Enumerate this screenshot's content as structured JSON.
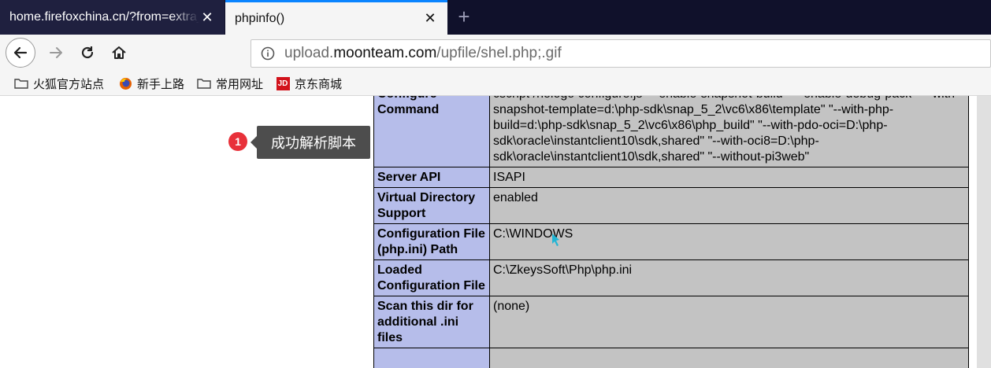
{
  "tabs": [
    {
      "title": "home.firefoxchina.cn/?from=extra_start",
      "active": false
    },
    {
      "title": "phpinfo()",
      "active": true
    }
  ],
  "nav": {
    "url_prefix": "upload.",
    "url_domain": "moonteam.com",
    "url_path": "/upfile/shel.php;.gif"
  },
  "bookmarks": [
    {
      "label": "火狐官方站点",
      "icon": "folder-icon"
    },
    {
      "label": "新手上路",
      "icon": "firefox-icon"
    },
    {
      "label": "常用网址",
      "icon": "folder-icon"
    },
    {
      "label": "京东商城",
      "icon": "jd-icon",
      "icon_text": "JD"
    }
  ],
  "tooltip": {
    "step": "1",
    "text": "成功解析脚本"
  },
  "phpinfo": {
    "rows": [
      {
        "key": "Configure Command",
        "value": "cscript /nologo configure.js \"--enable-snapshot-build\" \"--enable-debug-pack\" \"--with-snapshot-template=d:\\php-sdk\\snap_5_2\\vc6\\x86\\template\" \"--with-php-build=d:\\php-sdk\\snap_5_2\\vc6\\x86\\php_build\" \"--with-pdo-oci=D:\\php-sdk\\oracle\\instantclient10\\sdk,shared\" \"--with-oci8=D:\\php-sdk\\oracle\\instantclient10\\sdk,shared\" \"--without-pi3web\""
      },
      {
        "key": "Server API",
        "value": "ISAPI"
      },
      {
        "key": "Virtual Directory Support",
        "value": "enabled"
      },
      {
        "key": "Configuration File (php.ini) Path",
        "value": "C:\\WINDOWS"
      },
      {
        "key": "Loaded Configuration File",
        "value": "C:\\ZkeysSoft\\Php\\php.ini"
      },
      {
        "key": "Scan this dir for additional .ini files",
        "value": "(none)"
      },
      {
        "key": "",
        "value": ""
      }
    ]
  },
  "colors": {
    "tabstrip": "#10112b",
    "key_cell": "#b6bdea",
    "value_cell": "#c3c3c3",
    "badge": "#e8313a",
    "tooltip": "#4d4d4d"
  }
}
